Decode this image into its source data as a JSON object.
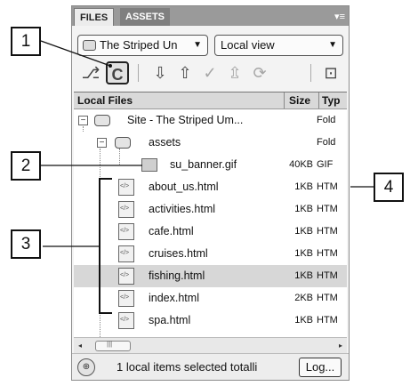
{
  "tabs": {
    "files": "FILES",
    "assets": "ASSETS",
    "menu_glyph": "▾≡"
  },
  "site_select": {
    "value": "The Striped Un",
    "arrow": "▼"
  },
  "view_select": {
    "value": "Local view",
    "arrow": "▼"
  },
  "toolbar": {
    "connect": "⎇",
    "refresh": "C",
    "get": "⇩",
    "put": "⇧",
    "check_out": "✓",
    "check_in": "⇫",
    "synchronize": "⟳",
    "expand": "⊡"
  },
  "columns": {
    "name": "Local Files",
    "size": "Size",
    "type": "Typ"
  },
  "tree": [
    {
      "label": "Site - The Striped Um...",
      "size": "",
      "type": "Fold",
      "kind": "site"
    },
    {
      "label": "assets",
      "size": "",
      "type": "Fold",
      "kind": "folder"
    },
    {
      "label": "su_banner.gif",
      "size": "40KB",
      "type": "GIF",
      "kind": "image"
    },
    {
      "label": "about_us.html",
      "size": "1KB",
      "type": "HTM",
      "kind": "html"
    },
    {
      "label": "activities.html",
      "size": "1KB",
      "type": "HTM",
      "kind": "html"
    },
    {
      "label": "cafe.html",
      "size": "1KB",
      "type": "HTM",
      "kind": "html"
    },
    {
      "label": "cruises.html",
      "size": "1KB",
      "type": "HTM",
      "kind": "html"
    },
    {
      "label": "fishing.html",
      "size": "1KB",
      "type": "HTM",
      "kind": "html",
      "selected": true
    },
    {
      "label": "index.html",
      "size": "2KB",
      "type": "HTM",
      "kind": "html"
    },
    {
      "label": "spa.html",
      "size": "1KB",
      "type": "HTM",
      "kind": "html"
    }
  ],
  "expanders": {
    "site": "−",
    "assets": "−"
  },
  "scrollbar": {
    "left": "◂",
    "right": "▸"
  },
  "status": {
    "text": "1 local items selected totalli",
    "log_button": "Log..."
  },
  "callouts": [
    "1",
    "2",
    "3",
    "4"
  ],
  "colors": {
    "selected_row": "#d7d7d7",
    "tab_bar": "#9a9a9a",
    "header": "#d9d9d9"
  }
}
